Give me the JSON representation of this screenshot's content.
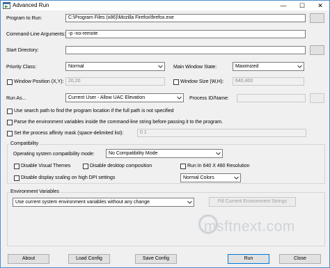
{
  "window": {
    "title": "Advanced Run",
    "controls": {
      "minimize": "—",
      "maximize": "☐",
      "close": "✕"
    }
  },
  "program_to_run": {
    "label": "Program to Run:",
    "value": "C:\\Program Files (x86)\\Mozilla Firefox\\firefox.exe"
  },
  "command_line": {
    "label": "Command-Line Arguments:",
    "value": "-p -no-remote"
  },
  "start_directory": {
    "label": "Start Directory:",
    "value": ""
  },
  "priority_class": {
    "label": "Priority Class:",
    "value": "Normal"
  },
  "main_window_state": {
    "label": "Main Window State:",
    "value": "Maximized"
  },
  "window_position": {
    "label": "Window Position (X,Y):",
    "value": "20,20"
  },
  "window_size": {
    "label": "Window Size (W,H):",
    "value": "640,400"
  },
  "run_as": {
    "label": "Run As...",
    "value": "Current User - Allow UAC Elevation"
  },
  "process_id": {
    "label": "Process ID/Name:",
    "value": ""
  },
  "options": {
    "search_path": "Use search path to find the program location if the full path is not specified",
    "parse_env": "Parse the environment variables inside the command-line string before passing it to the program.",
    "affinity_label": "Set the process affinity mask (space-delimited list):",
    "affinity_value": "0 1"
  },
  "compatibility": {
    "group_label": "Compatibility",
    "os_mode_label": "Operating system compatibility mode:",
    "os_mode_value": "No Compatibility Mode",
    "disable_visual_themes": "Disable Visual Themes",
    "disable_desktop_composition": "Disable desktop composition",
    "run_640": "Run In 640 X 480 Resolution",
    "disable_dpi_scaling": "Disable display scaling on high DPI settings",
    "colors_value": "Normal Colors"
  },
  "environment": {
    "group_label": "Environment Variables",
    "mode_value": "Use current system environment variables without any change",
    "fill_button": "Fill Current Environment Strings"
  },
  "watermark": "msftnext.com",
  "buttons": {
    "about": "About",
    "load_config": "Load Config",
    "save_config": "Save Config",
    "run": "Run",
    "close": "Close"
  }
}
